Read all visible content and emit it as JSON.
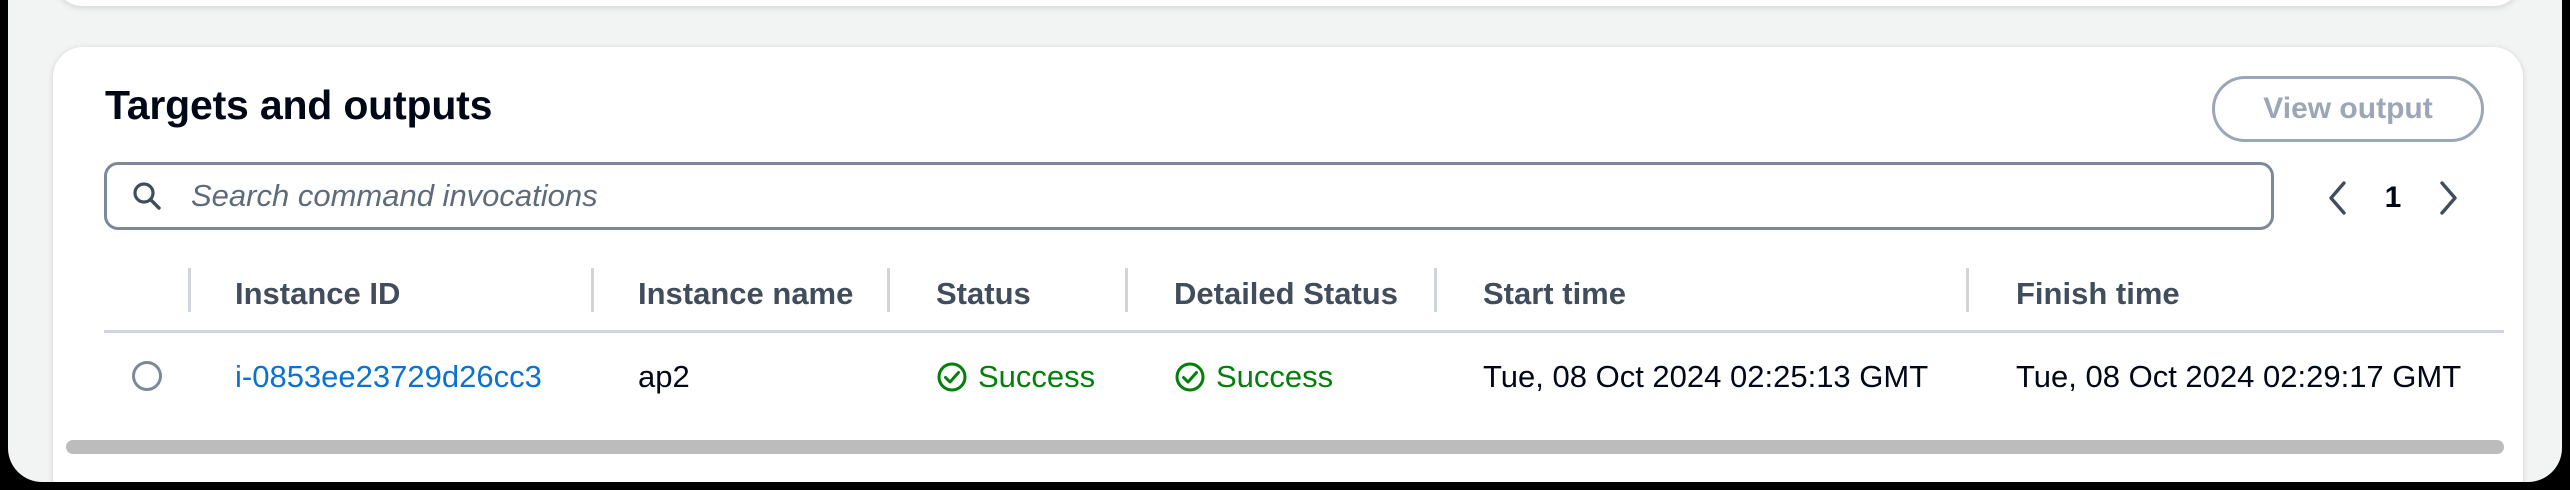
{
  "panel": {
    "title": "Targets and outputs",
    "view_output_label": "View output"
  },
  "search": {
    "placeholder": "Search command invocations",
    "icon": "search-icon"
  },
  "pagination": {
    "current_page": "1",
    "prev_icon": "chevron-left-icon",
    "next_icon": "chevron-right-icon"
  },
  "table": {
    "columns": [
      "Instance ID",
      "Instance name",
      "Status",
      "Detailed Status",
      "Start time",
      "Finish time"
    ],
    "rows": [
      {
        "instance_id": "i-0853ee23729d26cc3",
        "instance_name": "ap2",
        "status": "Success",
        "detailed_status": "Success",
        "start_time": "Tue, 08 Oct 2024 02:25:13 GMT",
        "finish_time": "Tue, 08 Oct 2024 02:29:17 GMT"
      }
    ]
  },
  "colors": {
    "link": "#0972d3",
    "success": "#037f0c",
    "disabled_button": "#9ba7b6"
  }
}
